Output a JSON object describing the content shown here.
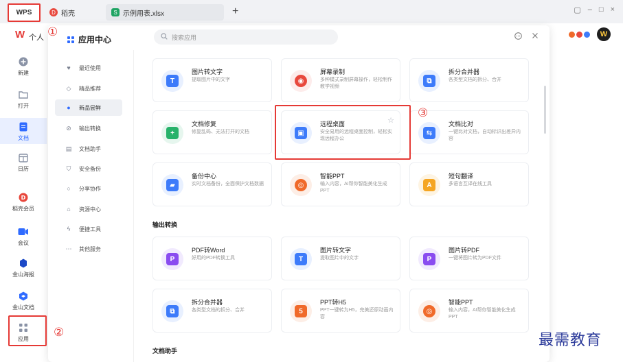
{
  "tabs": {
    "wps": "WPS",
    "daoke": {
      "label": "稻壳",
      "icon": "daoke-icon",
      "color": "#e8483d"
    },
    "xlsx": {
      "label": "示例用表.xlsx",
      "icon": "spreadsheet-icon",
      "color": "#1fa463"
    },
    "add": "+"
  },
  "window_controls": {
    "tile": "▢",
    "minimize": "–",
    "maximize": "□",
    "close": "×"
  },
  "header": {
    "personal": "个人"
  },
  "rail": [
    {
      "label": "新建",
      "icon": "plus-icon"
    },
    {
      "label": "打开",
      "icon": "folder-icon"
    },
    {
      "label": "文档",
      "icon": "document-icon",
      "active": true
    },
    {
      "label": "日历",
      "icon": "calendar-icon"
    },
    {
      "label": "稻壳会员",
      "icon": "daoke-member-icon"
    },
    {
      "label": "会议",
      "icon": "meeting-icon"
    },
    {
      "label": "金山海报",
      "icon": "poster-icon"
    },
    {
      "label": "金山文档",
      "icon": "kingsoft-docs-icon"
    },
    {
      "label": "应用",
      "icon": "apps-grid-icon"
    }
  ],
  "panel": {
    "title": "应用中心",
    "search_placeholder": "搜索应用",
    "categories": [
      {
        "label": "最近使用",
        "icon": "heart-icon"
      },
      {
        "label": "精品推荐",
        "icon": "diamond-icon"
      },
      {
        "label": "新品尝鲜",
        "icon": "flame-icon",
        "active": true
      },
      {
        "label": "输出转换",
        "icon": "convert-icon"
      },
      {
        "label": "文档助手",
        "icon": "doc-helper-icon"
      },
      {
        "label": "安全备份",
        "icon": "shield-icon"
      },
      {
        "label": "分享协作",
        "icon": "share-icon"
      },
      {
        "label": "资源中心",
        "icon": "resource-icon"
      },
      {
        "label": "便捷工具",
        "icon": "bolt-icon"
      },
      {
        "label": "其他服务",
        "icon": "more-icon"
      }
    ],
    "apps_new": [
      {
        "name": "图片转文字",
        "desc": "提取图片中的文字",
        "icon": "image-to-text-icon",
        "color": "#3d7bfa",
        "bg": "#e8f0ff"
      },
      {
        "name": "屏幕录制",
        "desc": "多种模式录制屏幕操作，轻松制作教学视频",
        "icon": "screen-record-icon",
        "color": "#e8483d",
        "bg": "#fdeceb"
      },
      {
        "name": "拆分合并器",
        "desc": "各类型文档的拆分、合并",
        "icon": "split-merge-icon",
        "color": "#3d7bfa",
        "bg": "#e8f0ff"
      },
      {
        "name": "文档修复",
        "desc": "修复乱码、无法打开的文档",
        "icon": "doc-repair-icon",
        "color": "#27b26a",
        "bg": "#e6f6ee"
      },
      {
        "name": "远程桌面",
        "desc": "安全易用的远程桌面控制，轻松实现远程办公",
        "icon": "remote-desktop-icon",
        "color": "#3d7bfa",
        "bg": "#e8f0ff"
      },
      {
        "name": "文档比对",
        "desc": "一键比对文档，自动标识出差异内容",
        "icon": "doc-compare-icon",
        "color": "#3d7bfa",
        "bg": "#e8f0ff"
      },
      {
        "name": "备份中心",
        "desc": "实时文档备份，全面保护文档数据",
        "icon": "backup-icon",
        "color": "#3d7bfa",
        "bg": "#e8f0ff"
      },
      {
        "name": "智能PPT",
        "desc": "输入内容，AI帮你智能美化生成PPT",
        "icon": "smart-ppt-icon",
        "color": "#f06a2a",
        "bg": "#fdeee6"
      },
      {
        "name": "短句翻译",
        "desc": "多语言互译在线工具",
        "icon": "translate-icon",
        "color": "#f5a623",
        "bg": "#fef4e2"
      }
    ],
    "section_output": "输出转换",
    "apps_output": [
      {
        "name": "PDF转Word",
        "desc": "好用的PDF转换工具",
        "icon": "pdf-to-word-icon",
        "color": "#8a4cf0",
        "bg": "#f1eafe"
      },
      {
        "name": "图片转文字",
        "desc": "提取图片中的文字",
        "icon": "image-to-text-icon",
        "color": "#3d7bfa",
        "bg": "#e8f0ff"
      },
      {
        "name": "图片转PDF",
        "desc": "一键将图片转为PDF文件",
        "icon": "image-to-pdf-icon",
        "color": "#8a4cf0",
        "bg": "#f1eafe"
      },
      {
        "name": "拆分合并器",
        "desc": "各类型文档的拆分、合并",
        "icon": "split-merge-icon",
        "color": "#3d7bfa",
        "bg": "#e8f0ff"
      },
      {
        "name": "PPT转H5",
        "desc": "PPT一键转为H5，完美还原动画内容",
        "icon": "ppt-to-h5-icon",
        "color": "#f06a2a",
        "bg": "#fdeee6"
      },
      {
        "name": "智能PPT",
        "desc": "输入内容，AI帮你智能美化生成PPT",
        "icon": "smart-ppt-icon",
        "color": "#f06a2a",
        "bg": "#fdeee6"
      }
    ],
    "section_helper": "文档助手"
  },
  "annotations": {
    "n1": "①",
    "n2": "②",
    "n3": "③"
  },
  "watermark": "最需教育"
}
